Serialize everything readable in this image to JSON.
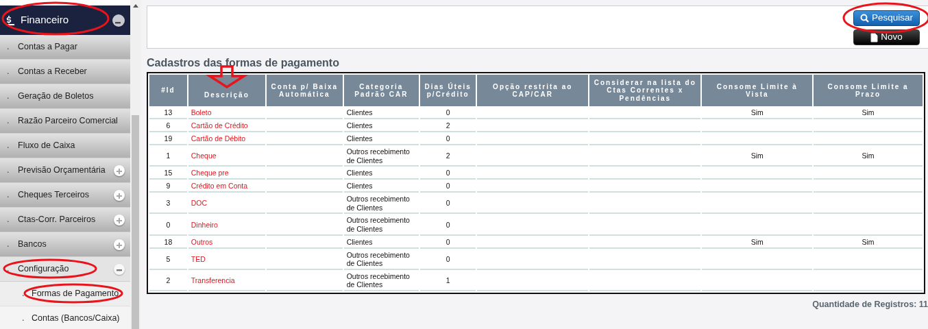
{
  "sidebar": {
    "header": {
      "label": "Financeiro",
      "expanded": true
    },
    "items": [
      {
        "marker": ".",
        "label": "Contas a Pagar",
        "selected": false
      },
      {
        "marker": ".",
        "label": "Contas a Receber",
        "selected": false
      },
      {
        "marker": ".",
        "label": "Geração de Boletos",
        "selected": false
      },
      {
        "marker": ".",
        "label": "Razão Parceiro Comercial",
        "selected": false
      },
      {
        "marker": ".",
        "label": "Fluxo de Caixa",
        "selected": false
      },
      {
        "marker": ".",
        "label": "Previsão Orçamentária",
        "selected": false,
        "expanded": false
      },
      {
        "marker": ".",
        "label": "Cheques Terceiros",
        "selected": false,
        "expanded": false
      },
      {
        "marker": ".",
        "label": "Ctas-Corr. Parceiros",
        "selected": false,
        "expanded": false
      },
      {
        "marker": ".",
        "label": "Bancos",
        "selected": false,
        "expanded": false
      },
      {
        "marker": ".",
        "label": "Configuração",
        "selected": true,
        "expanded": true,
        "children": [
          {
            "marker": ".",
            "label": "Formas de Pagamento",
            "selected": true
          },
          {
            "marker": ".",
            "label": "Contas (Bancos/Caixa)",
            "selected": false
          }
        ]
      }
    ]
  },
  "buttons": [
    {
      "label": "Pesquisar",
      "kind": "search"
    },
    {
      "label": "Novo",
      "kind": "new"
    }
  ],
  "table": {
    "title": "Cadastros das formas de pagamento",
    "columns": [
      "#Id",
      "Descrição",
      "Conta p/ Baixa Automática",
      "Categoria Padrão CAR",
      "Dias Úteis p/Crédito",
      "Opção restrita ao CAP/CAR",
      "Considerar na lista do Ctas Correntes x Pendências",
      "Consome Limite à Vista",
      "Consome Limite a Prazo"
    ],
    "rows": [
      [
        "13",
        "Boleto",
        null,
        "Clientes",
        "0",
        null,
        null,
        "Sim",
        "Sim"
      ],
      [
        "6",
        "Cartão de Crédito",
        null,
        "Clientes",
        "2",
        null,
        null,
        null,
        null
      ],
      [
        "19",
        "Cartão de Débito",
        null,
        "Clientes",
        "0",
        null,
        null,
        null,
        null
      ],
      [
        "1",
        "Cheque",
        null,
        "Outros recebimento de Clientes",
        "2",
        null,
        null,
        "Sim",
        "Sim"
      ],
      [
        "15",
        "Cheque pre",
        null,
        "Clientes",
        "0",
        null,
        null,
        null,
        null
      ],
      [
        "9",
        "Crédito em Conta",
        null,
        "Clientes",
        "0",
        null,
        null,
        null,
        null
      ],
      [
        "3",
        "DOC",
        null,
        "Outros recebimento de Clientes",
        "0",
        null,
        null,
        null,
        null
      ],
      [
        "0",
        "Dinheiro",
        null,
        "Outros recebimento de Clientes",
        "0",
        null,
        null,
        null,
        null
      ],
      [
        "18",
        "Outros",
        null,
        "Clientes",
        "0",
        null,
        null,
        "Sim",
        "Sim"
      ],
      [
        "5",
        "TED",
        null,
        "Outros recebimento de Clientes",
        "0",
        null,
        null,
        null,
        null
      ],
      [
        "2",
        "Transferencia",
        null,
        "Outros recebimento de Clientes",
        "1",
        null,
        null,
        null,
        null
      ]
    ]
  },
  "record_count": "Quantidade de Registros: 11"
}
